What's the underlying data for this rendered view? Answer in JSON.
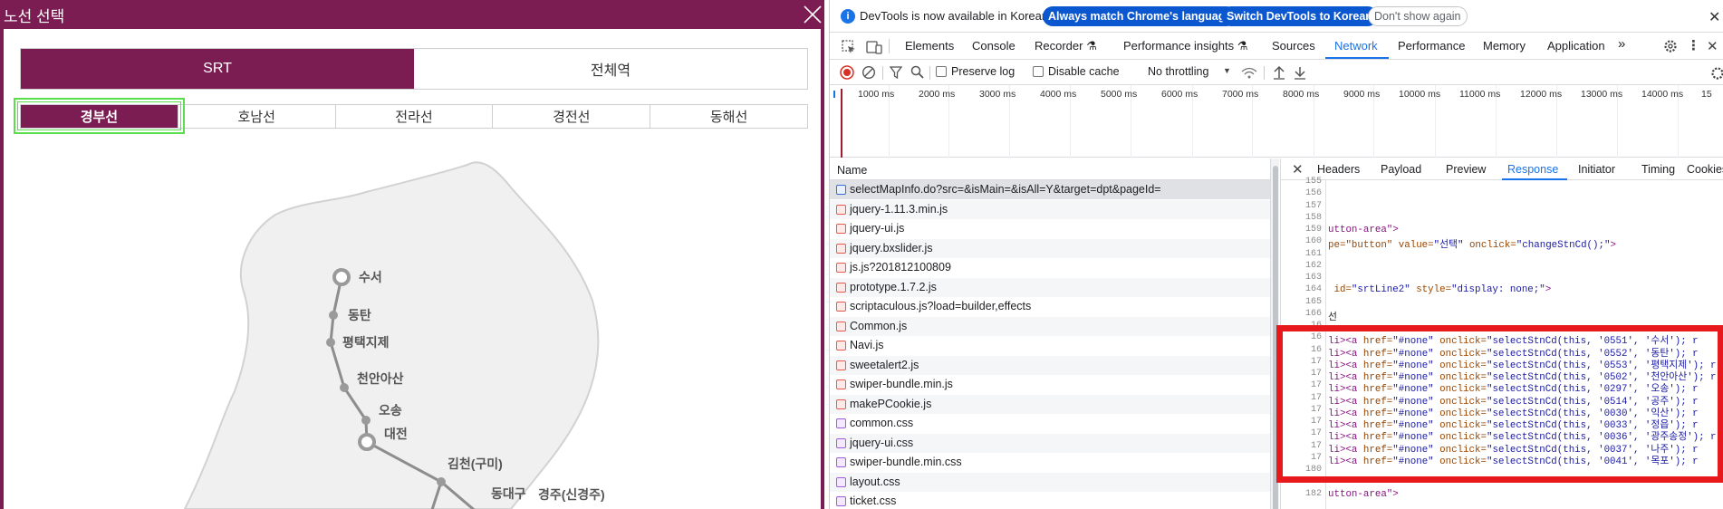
{
  "popup": {
    "title": "노선 선택",
    "top_tabs": [
      {
        "label": "SRT",
        "active": true
      },
      {
        "label": "전체역",
        "active": false
      }
    ],
    "line_tabs": [
      {
        "label": "경부선",
        "active": true
      },
      {
        "label": "호남선",
        "active": false
      },
      {
        "label": "전라선",
        "active": false
      },
      {
        "label": "경전선",
        "active": false
      },
      {
        "label": "동해선",
        "active": false
      }
    ],
    "stations": [
      "수서",
      "동탄",
      "평택지제",
      "천안아산",
      "오송",
      "대전",
      "김천(구미)",
      "동대구",
      "경주(신경주)"
    ]
  },
  "devtools": {
    "infobar": {
      "text": "DevTools is now available in Korean!",
      "match_button": "Always match Chrome's language",
      "switch_button": "Switch DevTools to Korean",
      "dismiss_button": "Don't show again"
    },
    "panels": [
      "Elements",
      "Console",
      "Recorder ⚗",
      "Performance insights ⚗",
      "Sources",
      "Network",
      "Performance",
      "Memory",
      "Application",
      "»"
    ],
    "active_panel": "Network",
    "toolbar": {
      "preserve_log": "Preserve log",
      "disable_cache": "Disable cache",
      "throttling": "No throttling"
    },
    "timeline_ticks": [
      "1000 ms",
      "2000 ms",
      "3000 ms",
      "4000 ms",
      "5000 ms",
      "6000 ms",
      "7000 ms",
      "8000 ms",
      "9000 ms",
      "10000 ms",
      "11000 ms",
      "12000 ms",
      "13000 ms",
      "14000 ms",
      "15"
    ],
    "name_header": "Name",
    "requests": [
      {
        "name": "selectMapInfo.do?src=&isMain=&isAll=Y&target=dpt&pageId=",
        "type": "doc"
      },
      {
        "name": "jquery-1.11.3.min.js",
        "type": "js"
      },
      {
        "name": "jquery-ui.js",
        "type": "js"
      },
      {
        "name": "jquery.bxslider.js",
        "type": "js"
      },
      {
        "name": "js.js?201812100809",
        "type": "js"
      },
      {
        "name": "prototype.1.7.2.js",
        "type": "js"
      },
      {
        "name": "scriptaculous.js?load=builder,effects",
        "type": "js"
      },
      {
        "name": "Common.js",
        "type": "js"
      },
      {
        "name": "Navi.js",
        "type": "js"
      },
      {
        "name": "sweetalert2.js",
        "type": "js"
      },
      {
        "name": "swiper-bundle.min.js",
        "type": "js"
      },
      {
        "name": "makePCookie.js",
        "type": "js"
      },
      {
        "name": "common.css",
        "type": "css"
      },
      {
        "name": "jquery-ui.css",
        "type": "css"
      },
      {
        "name": "swiper-bundle.min.css",
        "type": "css"
      },
      {
        "name": "layout.css",
        "type": "css"
      },
      {
        "name": "ticket.css",
        "type": "css"
      }
    ],
    "detail_tabs": [
      "Headers",
      "Payload",
      "Preview",
      "Response",
      "Initiator",
      "Timing",
      "Cookies"
    ],
    "active_detail_tab": "Response",
    "line_numbers": [
      "155",
      "156",
      "157",
      "158",
      "159",
      "160",
      "161",
      "162",
      "163",
      "164",
      "165",
      "166",
      "16",
      "16",
      "16",
      "17",
      "17",
      "17",
      "17",
      "17",
      "17",
      "17",
      "17",
      "17",
      "180",
      "181",
      "182"
    ],
    "code_lines": [
      {
        "text": "",
        "kind": "plain"
      },
      {
        "text": "",
        "kind": "plain"
      },
      {
        "text": "",
        "kind": "plain"
      },
      {
        "text": "",
        "kind": "plain"
      },
      {
        "text": "utton-area\">",
        "kind": "tag"
      },
      {
        "pre": "pe=\"button\" value=",
        "s1": "\"선택\"",
        "mid": " onclick=",
        "s2": "\"changeStnCd();\"",
        "post": ">",
        "kind": "attr"
      },
      {
        "text": "",
        "kind": "plain"
      },
      {
        "text": "",
        "kind": "plain"
      },
      {
        "text": "",
        "kind": "plain"
      },
      {
        "pre": " id=",
        "s1": "\"srtLine2\"",
        "mid": " style=",
        "s2": "\"display: none;\"",
        "post": ">",
        "kind": "attr"
      },
      {
        "text": "",
        "kind": "plain"
      },
      {
        "text": "선",
        "kind": "plain"
      },
      {
        "text": "",
        "kind": "plain"
      },
      {
        "code": "0551",
        "name": "수서",
        "kind": "li"
      },
      {
        "code": "0552",
        "name": "동탄",
        "kind": "li"
      },
      {
        "code": "0553",
        "name": "평택지제",
        "kind": "li"
      },
      {
        "code": "0502",
        "name": "천안아산",
        "kind": "li"
      },
      {
        "code": "0297",
        "name": "오송",
        "kind": "li"
      },
      {
        "code": "0514",
        "name": "공주",
        "kind": "li"
      },
      {
        "code": "0030",
        "name": "익산",
        "kind": "li"
      },
      {
        "code": "0033",
        "name": "정읍",
        "kind": "li"
      },
      {
        "code": "0036",
        "name": "광주송정",
        "kind": "li"
      },
      {
        "code": "0037",
        "name": "나주",
        "kind": "li"
      },
      {
        "code": "0041",
        "name": "목포",
        "kind": "li"
      },
      {
        "text": "",
        "kind": "plain"
      },
      {
        "text": "",
        "kind": "plain"
      },
      {
        "text": "utton-area\">",
        "kind": "tag"
      }
    ],
    "colors": {
      "accent": "#1a73e8",
      "record": "#d93025",
      "highlight": "#e8191c",
      "brand": "#7b1d52"
    }
  }
}
